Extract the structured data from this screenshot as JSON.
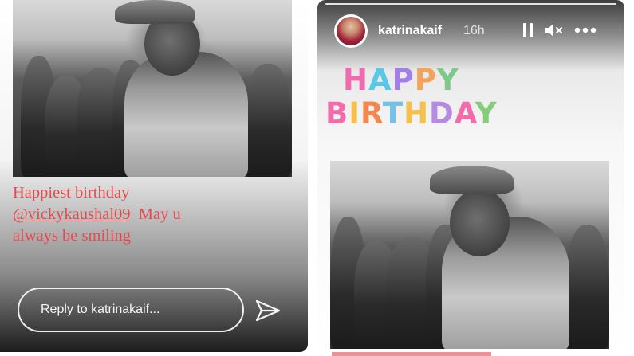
{
  "left_story": {
    "caption": {
      "line1": "Happiest birthday",
      "mention": "@vickykaushal09",
      "after_mention": "  May u",
      "line3": "always be smiling",
      "color": "#e8484c"
    },
    "reply": {
      "placeholder": "Reply to katrinakaif..."
    },
    "icons": {
      "send": "send-icon"
    }
  },
  "right_story": {
    "header": {
      "username": "katrinakaif",
      "time": "16h"
    },
    "icons": {
      "pause": "pause-icon",
      "mute": "mute-icon",
      "more": "more-icon"
    },
    "sticker": {
      "word1": [
        "H",
        "A",
        "P",
        "P",
        "Y"
      ],
      "word2": [
        "B",
        "I",
        "R",
        "T",
        "H",
        "D",
        "A",
        "Y"
      ],
      "colors1": [
        "#f06ab0",
        "#58c8e8",
        "#a27ee8",
        "#f3a45c",
        "#7cc98a"
      ],
      "colors2": [
        "#f36ba9",
        "#f5c04a",
        "#f4874e",
        "#75c2e6",
        "#f5c04a",
        "#b68ae0",
        "#f36ba9",
        "#86cc7c"
      ]
    }
  }
}
